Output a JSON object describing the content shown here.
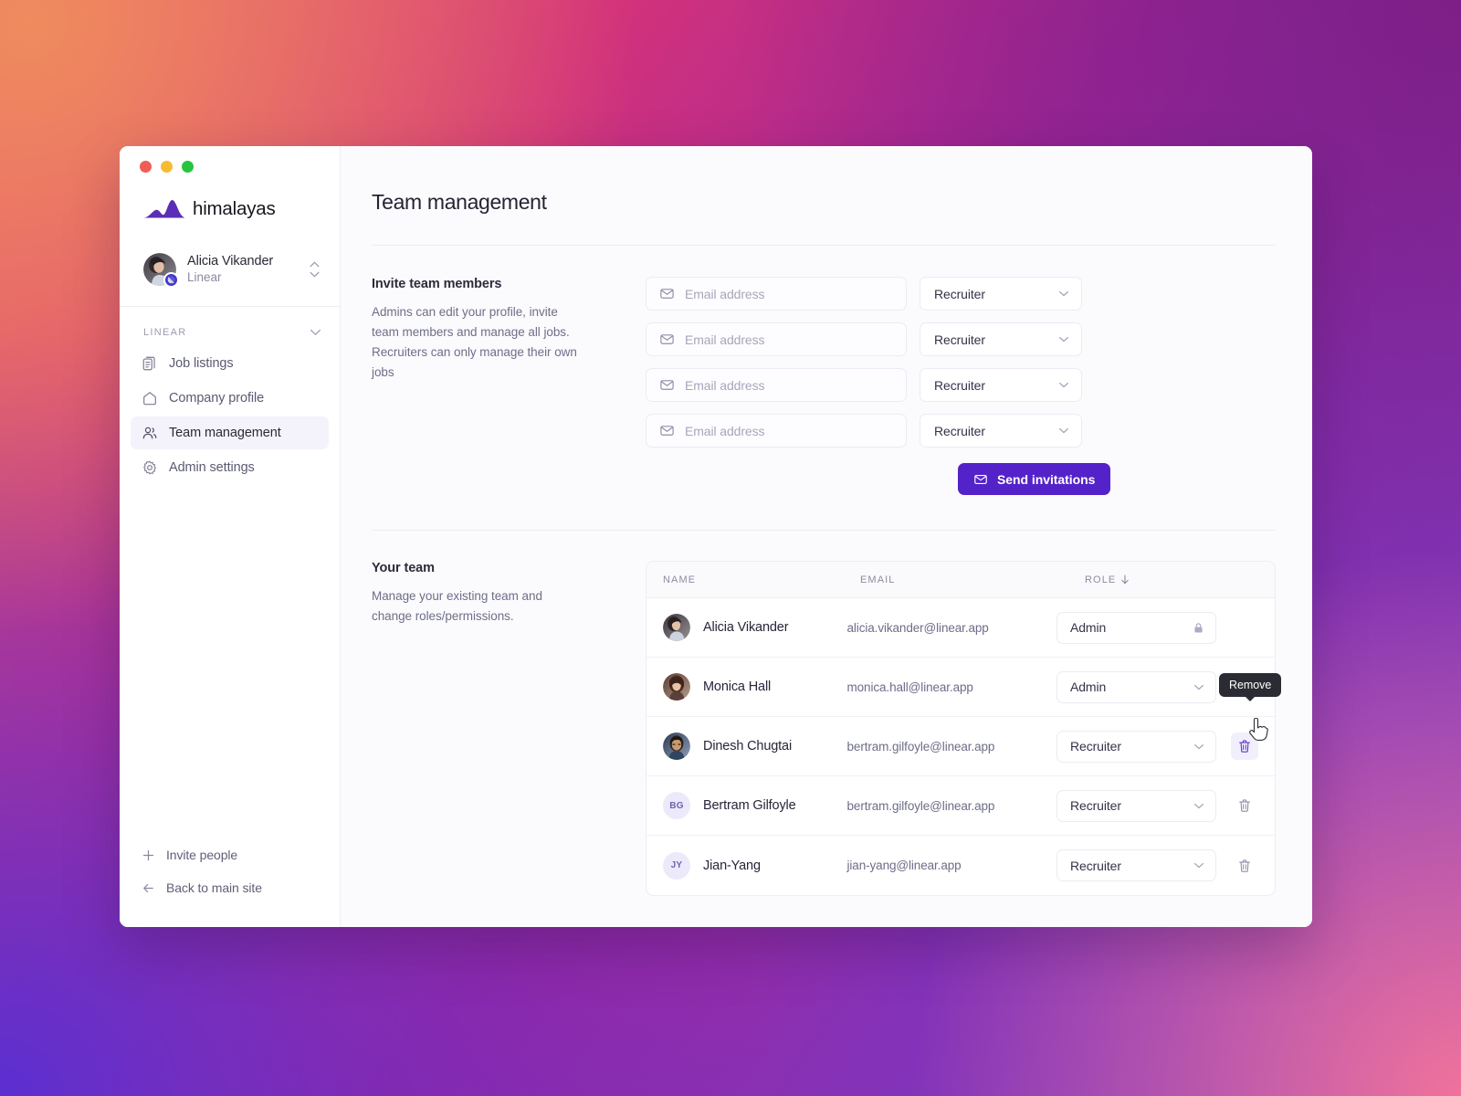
{
  "window": {
    "traffic_lights": [
      "close",
      "minimize",
      "maximize"
    ]
  },
  "sidebar": {
    "brand": {
      "name": "himalayas",
      "logo_icon": "mountain-logo"
    },
    "profile": {
      "name": "Alicia Vikander",
      "org": "Linear",
      "avatar_icon": "user-avatar-photo",
      "badge_icon": "linear-badge",
      "expander_icon": "chevron-up-down-icon"
    },
    "section": {
      "title": "LINEAR",
      "collapse_icon": "chevron-down-icon"
    },
    "items": [
      {
        "label": "Job listings",
        "icon": "documents-icon",
        "active": false
      },
      {
        "label": "Company profile",
        "icon": "home-icon",
        "active": false
      },
      {
        "label": "Team management",
        "icon": "users-icon",
        "active": true
      },
      {
        "label": "Admin settings",
        "icon": "gear-icon",
        "active": false
      }
    ],
    "footer": [
      {
        "label": "Invite people",
        "icon": "plus-icon"
      },
      {
        "label": "Back to main site",
        "icon": "arrow-left-icon"
      }
    ]
  },
  "main": {
    "page_title": "Team management",
    "invite": {
      "heading": "Invite team members",
      "description": "Admins can edit your profile, invite team members and manage all jobs. Recruiters can only manage their own jobs",
      "rows": [
        {
          "email_value": "",
          "email_placeholder": "Email address",
          "role": "Recruiter"
        },
        {
          "email_value": "",
          "email_placeholder": "Email address",
          "role": "Recruiter"
        },
        {
          "email_value": "",
          "email_placeholder": "Email address",
          "role": "Recruiter"
        },
        {
          "email_value": "",
          "email_placeholder": "Email address",
          "role": "Recruiter"
        }
      ],
      "role_options": [
        "Recruiter",
        "Admin"
      ],
      "submit_label": "Send  invitations",
      "submit_icon": "mail-icon",
      "submit_color": "#5422c9",
      "email_icon": "mail-icon",
      "chevron_icon": "chevron-down-icon"
    },
    "team": {
      "heading": "Your team",
      "description": "Manage your existing team and change roles/permissions.",
      "columns": [
        {
          "key": "name",
          "label": "NAME",
          "sorted": false
        },
        {
          "key": "email",
          "label": "EMAIL",
          "sorted": false
        },
        {
          "key": "role",
          "label": "ROLE",
          "sorted": true,
          "sort_icon": "arrow-down-icon"
        }
      ],
      "rows": [
        {
          "name": "Alicia Vikander",
          "email": "alicia.vikander@linear.app",
          "role": "Admin",
          "avatar_type": "photo",
          "avatar_tone": "alicia",
          "locked": true,
          "lock_icon": "lock-icon",
          "removable": false
        },
        {
          "name": "Monica Hall",
          "email": "monica.hall@linear.app",
          "role": "Admin",
          "avatar_type": "photo",
          "avatar_tone": "monica",
          "locked": false,
          "removable": true,
          "remove_icon": "trash-icon"
        },
        {
          "name": "Dinesh Chugtai",
          "email": "bertram.gilfoyle@linear.app",
          "role": "Recruiter",
          "avatar_type": "photo",
          "avatar_tone": "dinesh",
          "locked": false,
          "removable": true,
          "remove_icon": "trash-icon",
          "remove_hovered": true
        },
        {
          "name": "Bertram Gilfoyle",
          "email": "bertram.gilfoyle@linear.app",
          "role": "Recruiter",
          "avatar_type": "initials",
          "initials": "BG",
          "locked": false,
          "removable": true,
          "remove_icon": "trash-icon"
        },
        {
          "name": "Jian-Yang",
          "email": "jian-yang@linear.app",
          "role": "Recruiter",
          "avatar_type": "initials",
          "initials": "JY",
          "locked": false,
          "removable": true,
          "remove_icon": "trash-icon"
        }
      ]
    }
  },
  "tooltip": {
    "text": "Remove"
  },
  "cursor": {
    "icon": "pointing-hand-cursor"
  },
  "colors": {
    "brand_purple": "#5422c9",
    "logo_purple": "#5b2db8",
    "background_gradient_stops": [
      "#ef8b5e",
      "#e8566f",
      "#d2327b",
      "#a2269a",
      "#7b3fc4",
      "#5b2fd1"
    ]
  }
}
